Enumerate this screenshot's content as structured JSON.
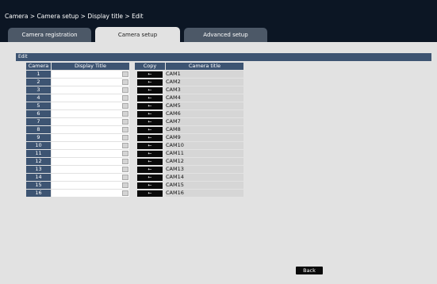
{
  "breadcrumb": "Camera > Camera setup > Display title > Edit",
  "tabs": [
    {
      "label": "Camera registration",
      "active": false
    },
    {
      "label": "Camera setup",
      "active": true
    },
    {
      "label": "Advanced setup",
      "active": false
    }
  ],
  "section_title": "Edit",
  "table": {
    "headers": {
      "camera": "Camera",
      "display_title": "Display Title",
      "copy": "Copy",
      "camera_title": "Camera title"
    },
    "copy_icon": "←",
    "rows": [
      {
        "num": "1",
        "display_title": "",
        "camera_title": "CAM1"
      },
      {
        "num": "2",
        "display_title": "",
        "camera_title": "CAM2"
      },
      {
        "num": "3",
        "display_title": "",
        "camera_title": "CAM3"
      },
      {
        "num": "4",
        "display_title": "",
        "camera_title": "CAM4"
      },
      {
        "num": "5",
        "display_title": "",
        "camera_title": "CAM5"
      },
      {
        "num": "6",
        "display_title": "",
        "camera_title": "CAM6"
      },
      {
        "num": "7",
        "display_title": "",
        "camera_title": "CAM7"
      },
      {
        "num": "8",
        "display_title": "",
        "camera_title": "CAM8"
      },
      {
        "num": "9",
        "display_title": "",
        "camera_title": "CAM9"
      },
      {
        "num": "10",
        "display_title": "",
        "camera_title": "CAM10"
      },
      {
        "num": "11",
        "display_title": "",
        "camera_title": "CAM11"
      },
      {
        "num": "12",
        "display_title": "",
        "camera_title": "CAM12"
      },
      {
        "num": "13",
        "display_title": "",
        "camera_title": "CAM13"
      },
      {
        "num": "14",
        "display_title": "",
        "camera_title": "CAM14"
      },
      {
        "num": "15",
        "display_title": "",
        "camera_title": "CAM15"
      },
      {
        "num": "16",
        "display_title": "",
        "camera_title": "CAM16"
      }
    ]
  },
  "back_label": "Back",
  "colors": {
    "title_bar": "#0c1624",
    "header_bg": "#3d5472",
    "panel_bg": "#e2e2e2",
    "button_bg": "#0a0a0a"
  }
}
